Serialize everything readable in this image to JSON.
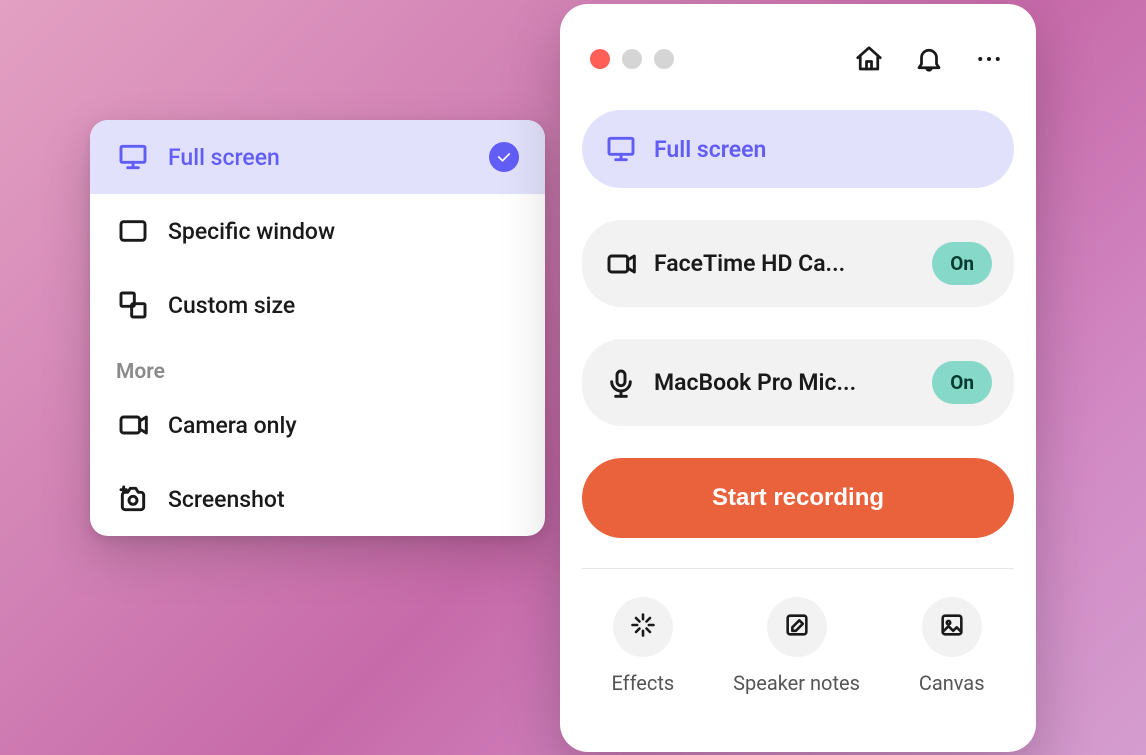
{
  "popover": {
    "items": [
      {
        "label": "Full screen"
      },
      {
        "label": "Specific window"
      },
      {
        "label": "Custom size"
      }
    ],
    "section_label": "More",
    "more_items": [
      {
        "label": "Camera only"
      },
      {
        "label": "Screenshot"
      }
    ]
  },
  "panel": {
    "screen_source": {
      "label": "Full screen"
    },
    "camera_source": {
      "label": "FaceTime HD Ca...",
      "badge": "On"
    },
    "mic_source": {
      "label": "MacBook Pro Mic...",
      "badge": "On"
    },
    "record_button": "Start recording",
    "footer": [
      {
        "label": "Effects"
      },
      {
        "label": "Speaker notes"
      },
      {
        "label": "Canvas"
      }
    ]
  }
}
